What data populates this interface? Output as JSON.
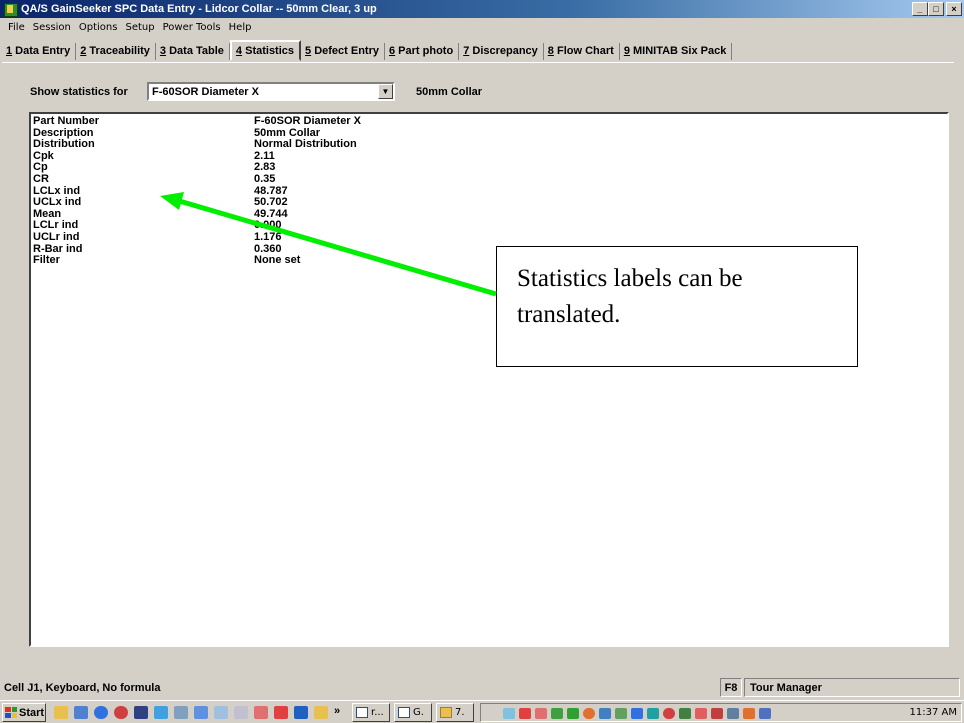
{
  "window": {
    "title": "QA/S GainSeeker SPC Data Entry - Lidcor Collar -- 50mm Clear, 3 up",
    "controls": [
      "_",
      "□",
      "×"
    ]
  },
  "menu": [
    "File",
    "Session",
    "Options",
    "Setup",
    "Power Tools",
    "Help"
  ],
  "tabs": [
    {
      "num": "1",
      "label": " Data Entry"
    },
    {
      "num": "2",
      "label": " Traceability"
    },
    {
      "num": "3",
      "label": " Data Table"
    },
    {
      "num": "4",
      "label": " Statistics"
    },
    {
      "num": "5",
      "label": " Defect Entry"
    },
    {
      "num": "6",
      "label": " Part photo"
    },
    {
      "num": "7",
      "label": " Discrepancy"
    },
    {
      "num": "8",
      "label": " Flow Chart"
    },
    {
      "num": "9",
      "label": " MINITAB Six Pack"
    }
  ],
  "active_tab": "4",
  "show_stats": {
    "label": "Show statistics for",
    "selected": "F-60SOR Diameter X",
    "part_description": "50mm Collar"
  },
  "statistics": [
    {
      "key": "Part Number",
      "value": "F-60SOR Diameter X"
    },
    {
      "key": "Description",
      "value": "50mm Collar"
    },
    {
      "key": "Distribution",
      "value": "Normal Distribution"
    },
    {
      "key": "Cpk",
      "value": "2.11"
    },
    {
      "key": "Cp",
      "value": "2.83"
    },
    {
      "key": "CR",
      "value": "0.35"
    },
    {
      "key": "LCLx ind",
      "value": "48.787"
    },
    {
      "key": "UCLx ind",
      "value": "50.702"
    },
    {
      "key": "Mean",
      "value": "49.744"
    },
    {
      "key": "LCLr ind",
      "value": "0.000"
    },
    {
      "key": "UCLr ind",
      "value": "1.176"
    },
    {
      "key": "R-Bar ind",
      "value": "0.360"
    },
    {
      "key": "Filter",
      "value": "None set"
    }
  ],
  "callout": {
    "line1": "Statistics labels can be",
    "line2": "translated."
  },
  "status": {
    "main": "Cell J1, Keyboard, No formula",
    "key": "F8",
    "tour": "Tour Manager"
  },
  "taskbar": {
    "start": "Start",
    "chevron": "»",
    "tasks": [
      "r...",
      "G.",
      "7."
    ],
    "clock": "11:37 AM"
  },
  "colors": {
    "arrow": "#00ee00",
    "title_start": "#0a246a",
    "title_end": "#a6caf0"
  }
}
